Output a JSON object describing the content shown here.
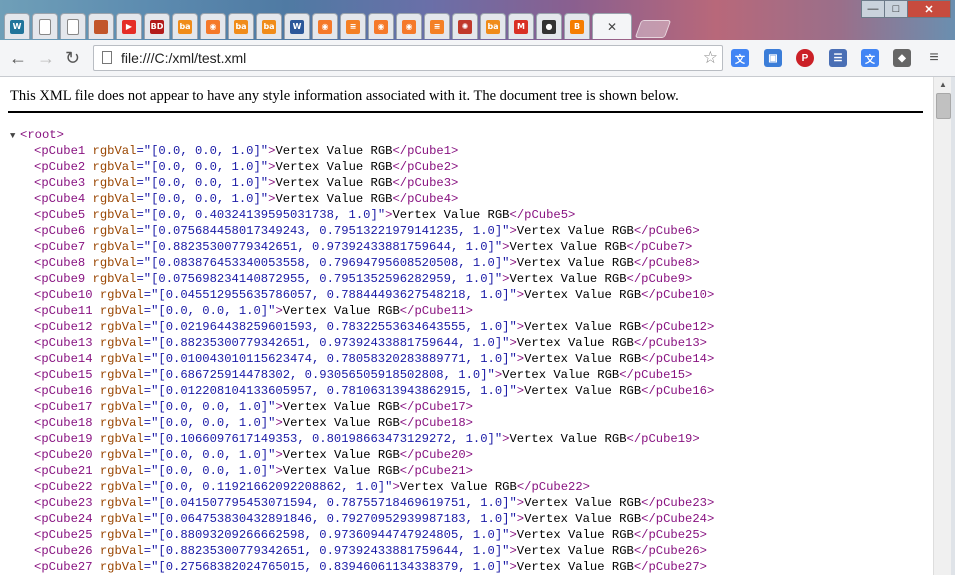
{
  "browser": {
    "tabs": [
      {
        "name": "wordpress-tab",
        "icon": "wordpress-icon",
        "label": "W",
        "color": "#21759b"
      },
      {
        "name": "document-tab-1",
        "icon": "document-icon",
        "label": "",
        "color": "#ffffff"
      },
      {
        "name": "document-tab-2",
        "icon": "document-icon",
        "label": "",
        "color": "#ffffff"
      },
      {
        "name": "hammer-tab",
        "icon": "hammer-icon",
        "label": "",
        "color": "#c2562b"
      },
      {
        "name": "youtube-tab",
        "icon": "youtube-icon",
        "label": "▶",
        "color": "#e52d27"
      },
      {
        "name": "bd-tab",
        "icon": "bd-icon",
        "label": "BD",
        "color": "#b31b1b"
      },
      {
        "name": "ba-tab-1",
        "icon": "ba-icon",
        "label": "ba",
        "color": "#f08c1a"
      },
      {
        "name": "blender-tab-1",
        "icon": "blender-icon",
        "label": "◉",
        "color": "#f5792a"
      },
      {
        "name": "ba-tab-2",
        "icon": "ba-icon",
        "label": "ba",
        "color": "#f08c1a"
      },
      {
        "name": "ba-tab-3",
        "icon": "ba-icon",
        "label": "ba",
        "color": "#f08c1a"
      },
      {
        "name": "word-tab",
        "icon": "word-icon",
        "label": "W",
        "color": "#2b579a"
      },
      {
        "name": "blender-tab-2",
        "icon": "blender-icon",
        "label": "◉",
        "color": "#f5792a"
      },
      {
        "name": "stack-tab-1",
        "icon": "stackoverflow-icon",
        "label": "≡",
        "color": "#f48024"
      },
      {
        "name": "blender-tab-3",
        "icon": "blender-icon",
        "label": "◉",
        "color": "#f5792a"
      },
      {
        "name": "blender-tab-4",
        "icon": "blender-icon",
        "label": "◉",
        "color": "#f5792a"
      },
      {
        "name": "stack-tab-2",
        "icon": "stackoverflow-icon",
        "label": "≡",
        "color": "#f48024"
      },
      {
        "name": "atom-tab",
        "icon": "atom-icon",
        "label": "✺",
        "color": "#c0392b"
      },
      {
        "name": "ba-tab-4",
        "icon": "ba-icon",
        "label": "ba",
        "color": "#f08c1a"
      },
      {
        "name": "gmail-tab",
        "icon": "gmail-icon",
        "label": "M",
        "color": "#d93025"
      },
      {
        "name": "github-tab",
        "icon": "github-icon",
        "label": "●",
        "color": "#333333"
      },
      {
        "name": "blogger-tab",
        "icon": "blogger-icon",
        "label": "B",
        "color": "#f57d00"
      }
    ],
    "active_tab": {
      "close_label": "✕"
    },
    "window": {
      "minimize": "—",
      "maximize": "□",
      "close": "✕"
    },
    "toolbar": {
      "back": "←",
      "forward": "→",
      "reload": "↻",
      "url": "file:///C:/xml/test.xml",
      "star": "☆"
    },
    "extensions": [
      {
        "name": "translate-extension-1",
        "icon": "translate-icon",
        "label": "文",
        "color": "#4285f4"
      },
      {
        "name": "screenshot-extension",
        "icon": "image-icon",
        "label": "▣",
        "color": "#3b7dd8"
      },
      {
        "name": "pinterest-extension",
        "icon": "pinterest-icon",
        "label": "P",
        "color": "#cb2027"
      },
      {
        "name": "notes-extension",
        "icon": "notes-icon",
        "label": "☰",
        "color": "#4a6fb5"
      },
      {
        "name": "translate-extension-2",
        "icon": "translate-icon",
        "label": "文",
        "color": "#4285f4"
      },
      {
        "name": "tag-extension",
        "icon": "tag-icon",
        "label": "◆",
        "color": "#666666"
      },
      {
        "name": "menu-button",
        "icon": "menu-icon",
        "label": "≡",
        "color": "#555555"
      }
    ]
  },
  "page": {
    "notice": "This XML file does not appear to have any style information associated with it. The document tree is shown below.",
    "root_tag": "<root>",
    "toggle": "▼",
    "nodes": [
      {
        "tag": "pCube1",
        "attr": "rgbVal",
        "value": "[0.0, 0.0, 1.0]",
        "text": "Vertex Value RGB"
      },
      {
        "tag": "pCube2",
        "attr": "rgbVal",
        "value": "[0.0, 0.0, 1.0]",
        "text": "Vertex Value RGB"
      },
      {
        "tag": "pCube3",
        "attr": "rgbVal",
        "value": "[0.0, 0.0, 1.0]",
        "text": "Vertex Value RGB"
      },
      {
        "tag": "pCube4",
        "attr": "rgbVal",
        "value": "[0.0, 0.0, 1.0]",
        "text": "Vertex Value RGB"
      },
      {
        "tag": "pCube5",
        "attr": "rgbVal",
        "value": "[0.0, 0.40324139595031738, 1.0]",
        "text": "Vertex Value RGB"
      },
      {
        "tag": "pCube6",
        "attr": "rgbVal",
        "value": "[0.075684458017349243, 0.79513221979141235, 1.0]",
        "text": "Vertex Value RGB"
      },
      {
        "tag": "pCube7",
        "attr": "rgbVal",
        "value": "[0.88235300779342651, 0.97392433881759644, 1.0]",
        "text": "Vertex Value RGB"
      },
      {
        "tag": "pCube8",
        "attr": "rgbVal",
        "value": "[0.083876453340053558, 0.79694795608520508, 1.0]",
        "text": "Vertex Value RGB"
      },
      {
        "tag": "pCube9",
        "attr": "rgbVal",
        "value": "[0.075698234140872955, 0.7951352596282959, 1.0]",
        "text": "Vertex Value RGB"
      },
      {
        "tag": "pCube10",
        "attr": "rgbVal",
        "value": "[0.045512955635786057, 0.78844493627548218, 1.0]",
        "text": "Vertex Value RGB"
      },
      {
        "tag": "pCube11",
        "attr": "rgbVal",
        "value": "[0.0, 0.0, 1.0]",
        "text": "Vertex Value RGB"
      },
      {
        "tag": "pCube12",
        "attr": "rgbVal",
        "value": "[0.021964438259601593, 0.78322553634643555, 1.0]",
        "text": "Vertex Value RGB"
      },
      {
        "tag": "pCube13",
        "attr": "rgbVal",
        "value": "[0.88235300779342651, 0.97392433881759644, 1.0]",
        "text": "Vertex Value RGB"
      },
      {
        "tag": "pCube14",
        "attr": "rgbVal",
        "value": "[0.010043010115623474, 0.78058320283889771, 1.0]",
        "text": "Vertex Value RGB"
      },
      {
        "tag": "pCube15",
        "attr": "rgbVal",
        "value": "[0.686725914478302, 0.93056505918502808, 1.0]",
        "text": "Vertex Value RGB"
      },
      {
        "tag": "pCube16",
        "attr": "rgbVal",
        "value": "[0.012208104133605957, 0.78106313943862915, 1.0]",
        "text": "Vertex Value RGB"
      },
      {
        "tag": "pCube17",
        "attr": "rgbVal",
        "value": "[0.0, 0.0, 1.0]",
        "text": "Vertex Value RGB"
      },
      {
        "tag": "pCube18",
        "attr": "rgbVal",
        "value": "[0.0, 0.0, 1.0]",
        "text": "Vertex Value RGB"
      },
      {
        "tag": "pCube19",
        "attr": "rgbVal",
        "value": "[0.1066097617149353, 0.80198663473129272, 1.0]",
        "text": "Vertex Value RGB"
      },
      {
        "tag": "pCube20",
        "attr": "rgbVal",
        "value": "[0.0, 0.0, 1.0]",
        "text": "Vertex Value RGB"
      },
      {
        "tag": "pCube21",
        "attr": "rgbVal",
        "value": "[0.0, 0.0, 1.0]",
        "text": "Vertex Value RGB"
      },
      {
        "tag": "pCube22",
        "attr": "rgbVal",
        "value": "[0.0, 0.11921662092208862, 1.0]",
        "text": "Vertex Value RGB"
      },
      {
        "tag": "pCube23",
        "attr": "rgbVal",
        "value": "[0.041507795453071594, 0.78755718469619751, 1.0]",
        "text": "Vertex Value RGB"
      },
      {
        "tag": "pCube24",
        "attr": "rgbVal",
        "value": "[0.064753830432891846, 0.79270952939987183, 1.0]",
        "text": "Vertex Value RGB"
      },
      {
        "tag": "pCube25",
        "attr": "rgbVal",
        "value": "[0.88093209266662598, 0.97360944747924805, 1.0]",
        "text": "Vertex Value RGB"
      },
      {
        "tag": "pCube26",
        "attr": "rgbVal",
        "value": "[0.88235300779342651, 0.97392433881759644, 1.0]",
        "text": "Vertex Value RGB"
      },
      {
        "tag": "pCube27",
        "attr": "rgbVal",
        "value": "[0.27568382024765015, 0.83946061134338379, 1.0]",
        "text": "Vertex Value RGB"
      }
    ]
  },
  "scrollbar": {
    "up_arrow": "▲"
  }
}
